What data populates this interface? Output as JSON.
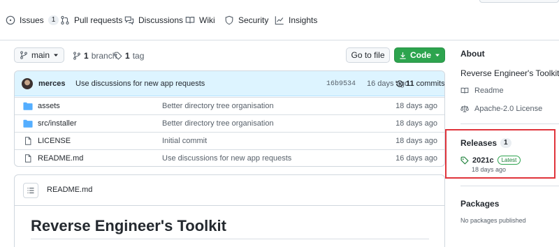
{
  "nav": {
    "issues_label": "Issues",
    "issues_count": "1",
    "pull_requests_label": "Pull requests",
    "discussions_label": "Discussions",
    "wiki_label": "Wiki",
    "security_label": "Security",
    "insights_label": "Insights"
  },
  "branch_bar": {
    "branch_name": "main",
    "branch_count": "1",
    "branch_word": "branch",
    "tag_count": "1",
    "tag_word": "tag",
    "goto_file_label": "Go to file",
    "code_label": "Code"
  },
  "latest_commit": {
    "author": "merces",
    "message": "Use discussions for new app requests",
    "sha": "16b9534",
    "age": "16 days ago",
    "commit_count": "11",
    "commit_word": "commits"
  },
  "files": [
    {
      "type": "folder",
      "name": "assets",
      "message": "Better directory tree organisation",
      "age": "18 days ago"
    },
    {
      "type": "folder",
      "name": "src/installer",
      "message": "Better directory tree organisation",
      "age": "18 days ago"
    },
    {
      "type": "file",
      "name": "LICENSE",
      "message": "Initial commit",
      "age": "18 days ago"
    },
    {
      "type": "file",
      "name": "README.md",
      "message": "Use discussions for new app requests",
      "age": "16 days ago"
    }
  ],
  "readme": {
    "filename": "README.md",
    "heading": "Reverse Engineer's Toolkit"
  },
  "sidebar": {
    "about_title": "About",
    "description": "Reverse Engineer's Toolkit",
    "readme_link": "Readme",
    "license_link": "Apache-2.0 License",
    "releases_title": "Releases",
    "releases_count": "1",
    "release_tag": "2021c",
    "release_badge": "Latest",
    "release_date": "18 days ago",
    "packages_title": "Packages",
    "packages_empty": "No packages published"
  },
  "colors": {
    "accent_green": "#2da44e",
    "highlight_red": "#e0343b",
    "commit_bar_blue": "#ddf4ff",
    "folder_blue": "#54aeff"
  }
}
